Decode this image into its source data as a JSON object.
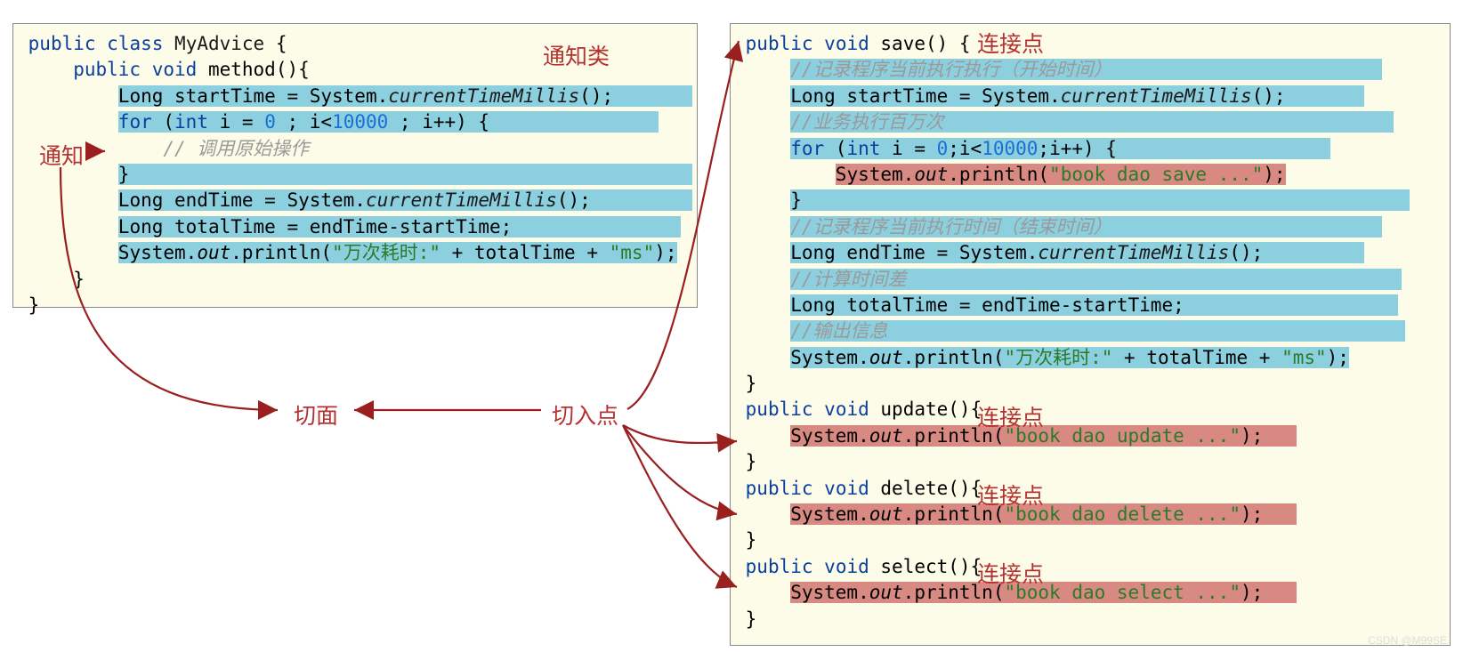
{
  "labels": {
    "advice_class": "通知类",
    "advice": "通知",
    "aspect": "切面",
    "pointcut": "切入点",
    "joinpoint1": "连接点",
    "joinpoint2": "连接点",
    "joinpoint3": "连接点",
    "joinpoint4": "连接点"
  },
  "left": {
    "l1a": "public",
    "l1b": "class",
    "l1c": "MyAdvice",
    "l1d": " {",
    "l2a": "public",
    "l2b": "void",
    "l2c": "method",
    "l2d": "(){",
    "l3a": "Long startTime = System.",
    "l3b": "currentTimeMillis",
    "l3c": "();",
    "l4a": "for",
    "l4b": " (",
    "l4c": "int",
    "l4d": " i = ",
    "l4e": "0",
    "l4f": " ; i<",
    "l4g": "10000",
    "l4h": " ; i++) {",
    "l5": "// 调用原始操作",
    "l6": "}",
    "l7a": "Long endTime = System.",
    "l7b": "currentTimeMillis",
    "l7c": "();",
    "l8": "Long totalTime = endTime-startTime;",
    "l9a": "System.",
    "l9b": "out",
    "l9c": ".println(",
    "l9d": "\"万次耗时:\"",
    "l9e": " + totalTime + ",
    "l9f": "\"ms\"",
    "l9g": ");",
    "l10": "}",
    "l11": "}"
  },
  "right": {
    "r1a": "public",
    "r1b": "void",
    "r1c": "save",
    "r1d": "() {",
    "r2": "//记录程序当前执行执行（开始时间）",
    "r3a": "Long startTime = System.",
    "r3b": "currentTimeMillis",
    "r3c": "();",
    "r4": "//业务执行百万次",
    "r5a": "for",
    "r5b": " (",
    "r5c": "int",
    "r5d": " i = ",
    "r5e": "0",
    "r5f": ";i<",
    "r5g": "10000",
    "r5h": ";i++) {",
    "r6a": "System.",
    "r6b": "out",
    "r6c": ".println(",
    "r6d": "\"book dao save ...\"",
    "r6e": ");",
    "r7": "}",
    "r8": "//记录程序当前执行时间（结束时间）",
    "r9a": "Long endTime = System.",
    "r9b": "currentTimeMillis",
    "r9c": "();",
    "r10": "//计算时间差",
    "r11": "Long totalTime = endTime-startTime;",
    "r12": "//输出信息",
    "r13a": "System.",
    "r13b": "out",
    "r13c": ".println(",
    "r13d": "\"万次耗时:\"",
    "r13e": " + totalTime + ",
    "r13f": "\"ms\"",
    "r13g": ");",
    "r14": "}",
    "r15a": "public",
    "r15b": "void",
    "r15c": "update",
    "r15d": "(){",
    "r16a": "System.",
    "r16b": "out",
    "r16c": ".println(",
    "r16d": "\"book dao update ...\"",
    "r16e": ");",
    "r17": "}",
    "r18a": "public",
    "r18b": "void",
    "r18c": "delete",
    "r18d": "(){",
    "r19a": "System.",
    "r19b": "out",
    "r19c": ".println(",
    "r19d": "\"book dao delete ...\"",
    "r19e": ");",
    "r20": "}",
    "r21a": "public",
    "r21b": "void",
    "r21c": "select",
    "r21d": "(){",
    "r22a": "System.",
    "r22b": "out",
    "r22c": ".println(",
    "r22d": "\"book dao select ...\"",
    "r22e": ");",
    "r23": "}"
  },
  "watermark": "CSDN @M99SE"
}
